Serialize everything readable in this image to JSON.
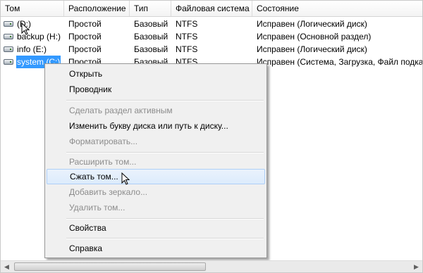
{
  "columns": [
    "Том",
    "Расположение",
    "Тип",
    "Файловая система",
    "Состояние"
  ],
  "volumes": [
    {
      "name": "(D:)",
      "location": "Простой",
      "type": "Базовый",
      "fs": "NTFS",
      "status": "Исправен (Логический диск)",
      "icon": "disk-icon"
    },
    {
      "name": "backup (H:)",
      "location": "Простой",
      "type": "Базовый",
      "fs": "NTFS",
      "status": "Исправен (Основной раздел)",
      "icon": "disk-icon"
    },
    {
      "name": "info (E:)",
      "location": "Простой",
      "type": "Базовый",
      "fs": "NTFS",
      "status": "Исправен (Логический диск)",
      "icon": "disk-icon"
    },
    {
      "name": "system (C:)",
      "location": "Простой",
      "type": "Базовый",
      "fs": "NTFS",
      "status": "Исправен (Система, Загрузка, Файл подкач",
      "icon": "disk-icon",
      "selected": true
    }
  ],
  "context_menu": {
    "items": [
      {
        "label": "Открыть",
        "enabled": true
      },
      {
        "label": "Проводник",
        "enabled": true
      },
      {
        "label": "Сделать раздел активным",
        "enabled": false
      },
      {
        "label": "Изменить букву диска или путь к диску...",
        "enabled": true
      },
      {
        "label": "Форматировать...",
        "enabled": false
      },
      {
        "label": "Расширить том...",
        "enabled": false
      },
      {
        "label": "Сжать том...",
        "enabled": true,
        "highlighted": true
      },
      {
        "label": "Добавить зеркало...",
        "enabled": false
      },
      {
        "label": "Удалить том...",
        "enabled": false
      },
      {
        "label": "Свойства",
        "enabled": true
      },
      {
        "label": "Справка",
        "enabled": true
      }
    ]
  },
  "colors": {
    "selection": "#3399ff",
    "menu_bg": "#f0f0f0",
    "disabled_text": "#8c8c8c",
    "highlight_border": "#aecff7"
  }
}
